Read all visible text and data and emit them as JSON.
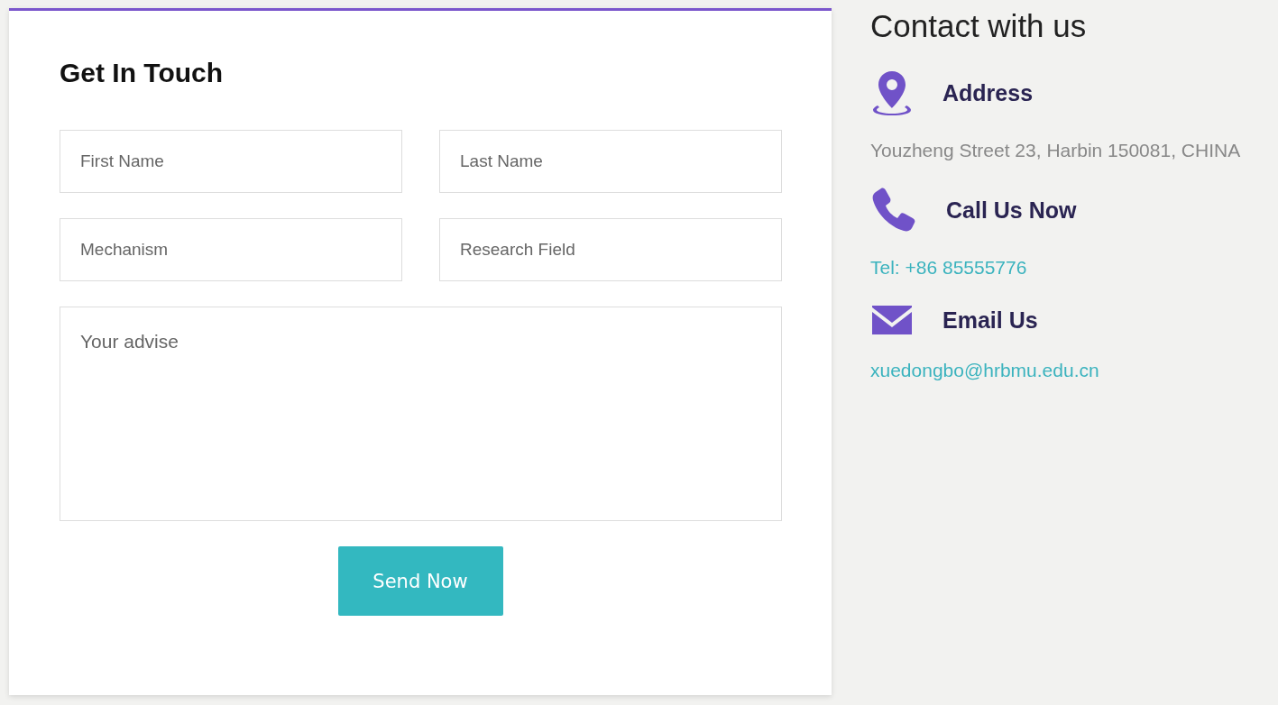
{
  "form": {
    "title": "Get In Touch",
    "fields": [
      {
        "placeholder": "First Name"
      },
      {
        "placeholder": "Last Name"
      },
      {
        "placeholder": "Mechanism"
      },
      {
        "placeholder": "Research Field"
      }
    ],
    "message": {
      "placeholder": "Your advise"
    },
    "submit": "Send Now"
  },
  "contact": {
    "title": "Contact with us",
    "items": [
      {
        "kind": "address",
        "title": "Address",
        "text": "Youzheng Street 23, Harbin 150081, CHINA"
      },
      {
        "kind": "phone",
        "title": "Call Us Now",
        "text": "Tel: +86 85555776"
      },
      {
        "kind": "email",
        "title": "Email Us",
        "text": "xuedongbo@hrbmu.edu.cn"
      }
    ]
  }
}
